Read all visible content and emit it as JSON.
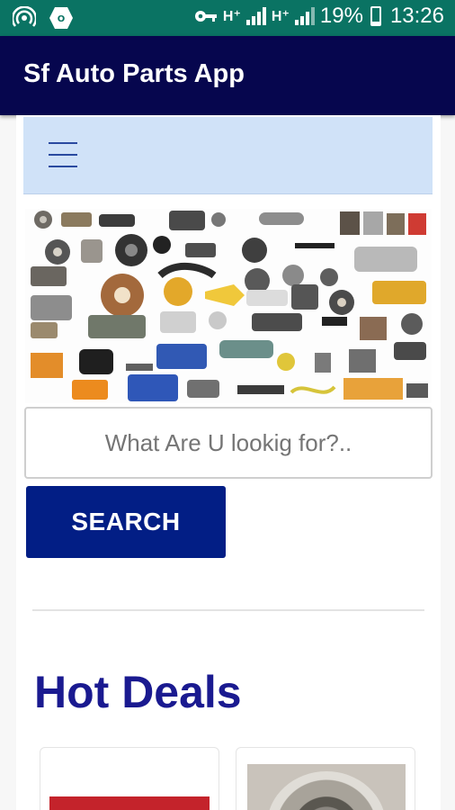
{
  "status_bar": {
    "battery": "19%",
    "time": "13:26",
    "network_1": "H⁺",
    "network_2": "H⁺",
    "icons": [
      "hotspot-icon",
      "vpn-icon",
      "key-icon",
      "signal-icon",
      "signal-icon",
      "battery-icon"
    ]
  },
  "app_bar": {
    "title": "Sf Auto Parts App"
  },
  "navbar": {
    "menu_icon": "hamburger-menu-icon"
  },
  "banner": {
    "subject": "auto parts collage"
  },
  "search": {
    "placeholder": "What Are U lookig for?..",
    "button_label": "SEARCH"
  },
  "section": {
    "title": "Hot Deals"
  },
  "deals": [
    {
      "image": "auto-part-product-image"
    },
    {
      "image": "bearing-product-image"
    }
  ],
  "colors": {
    "status_bar": "#0a7363",
    "app_bar": "#06064e",
    "navbar": "#d0e2f8",
    "button": "#021e85",
    "heading": "#1a1a90"
  }
}
